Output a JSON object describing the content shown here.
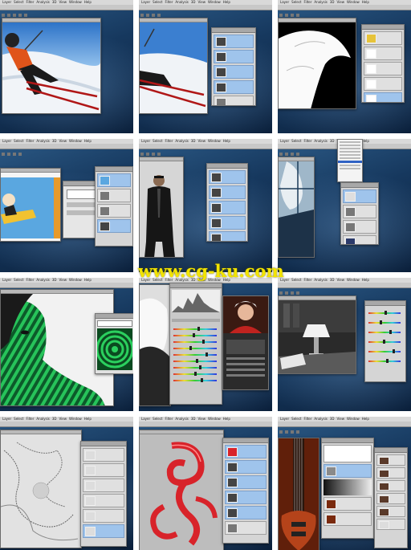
{
  "app": {
    "menu_items": [
      "Layer",
      "Select",
      "Filter",
      "Analysis",
      "3D",
      "View",
      "Window",
      "Help"
    ]
  },
  "watermark": {
    "text": "www.cg-ku.com"
  },
  "colors": {
    "desktop_blue": "#1d4670",
    "layer_highlight": "#9fc4ec",
    "watermark": "#f2e400",
    "flame_red": "#d8232a",
    "zebra_green": "#22a64a"
  },
  "tiles": [
    {
      "name": "skier-photo",
      "subject": "skier"
    },
    {
      "name": "skier-layers",
      "subject": "skier"
    },
    {
      "name": "hair-mask",
      "subject": "mask"
    },
    {
      "name": "snowboard-collage",
      "subject": "snowboard"
    },
    {
      "name": "man-portrait",
      "subject": "portrait"
    },
    {
      "name": "blue-portrait-blend-menu",
      "subject": "portrait"
    },
    {
      "name": "green-zebra-woman",
      "subject": "zebra"
    },
    {
      "name": "camera-raw-hdr",
      "subject": "camera-raw"
    },
    {
      "name": "lamp-interior",
      "subject": "lamp"
    },
    {
      "name": "sketch-map",
      "subject": "sketch"
    },
    {
      "name": "red-swirl-ornament",
      "subject": "swirl"
    },
    {
      "name": "guitar-compositing",
      "subject": "guitar"
    }
  ]
}
